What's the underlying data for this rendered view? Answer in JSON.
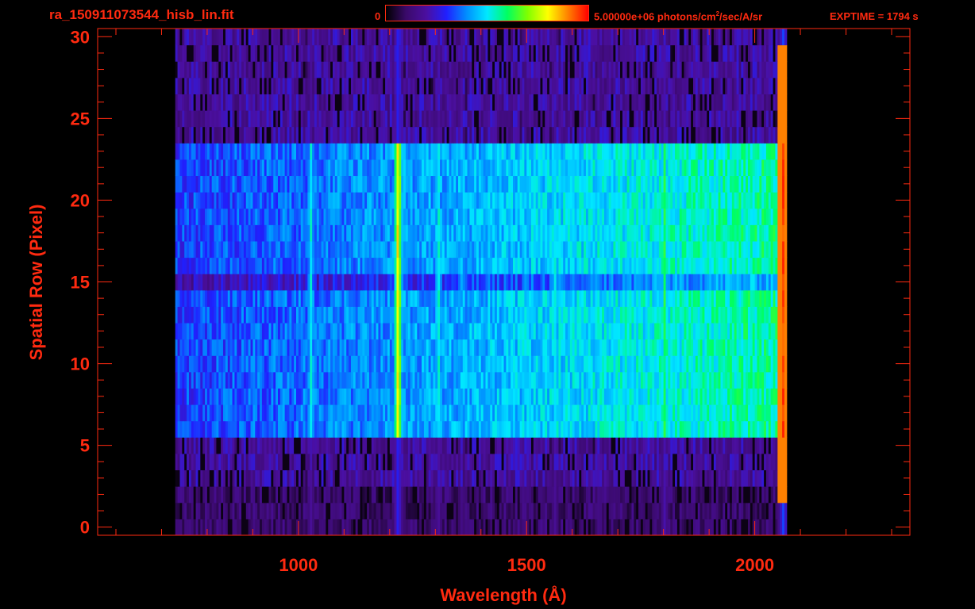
{
  "header": {
    "filename": "ra_150911073544_hisb_lin.fit",
    "colorbar_min_label": "0",
    "colorbar_max_label": "5.00000e+06 photons/cm",
    "colorbar_unit_sup": "2",
    "colorbar_unit_tail": "/sec/A/sr",
    "exptime": "EXPTIME = 1794 s"
  },
  "colors": {
    "axis": "#ff2a10",
    "colormap": [
      "#000000",
      "#3a0a6a",
      "#4b0fa0",
      "#2020ff",
      "#0090ff",
      "#00e8ff",
      "#00ff60",
      "#80ff00",
      "#ffff00",
      "#ff8000",
      "#ff0000"
    ]
  },
  "chart_data": {
    "type": "heatmap",
    "title": "",
    "xlabel": "Wavelength (Å)",
    "ylabel": "Spatial Row (Pixel)",
    "xlim": [
      560,
      2340
    ],
    "ylim": [
      -0.5,
      30.5
    ],
    "x_ticks": [
      1000,
      1500,
      2000
    ],
    "x_tick_labels": [
      "1000",
      "1500",
      "2000"
    ],
    "y_ticks": [
      0,
      5,
      10,
      15,
      20,
      25,
      30
    ],
    "y_tick_labels": [
      "0",
      "5",
      "10",
      "15",
      "20",
      "25",
      "30"
    ],
    "colorbar_range": [
      0,
      5000000
    ],
    "rows": 31,
    "signal_wavelength_range": [
      730,
      2070
    ],
    "slit_rows": [
      6,
      23
    ],
    "emission_features": [
      {
        "wavelength": 1025,
        "level": 0.52
      },
      {
        "wavelength": 1216,
        "level": 0.85
      },
      {
        "wavelength": 1304,
        "level": 0.55
      },
      {
        "wavelength": 1356,
        "level": 0.45
      },
      {
        "wavelength": 1493,
        "level": 0.45
      },
      {
        "wavelength": 1560,
        "level": 0.5
      },
      {
        "wavelength": 1657,
        "level": 0.48
      },
      {
        "wavelength": 1800,
        "level": 0.6
      },
      {
        "wavelength": 2060,
        "level": 0.95
      }
    ]
  }
}
